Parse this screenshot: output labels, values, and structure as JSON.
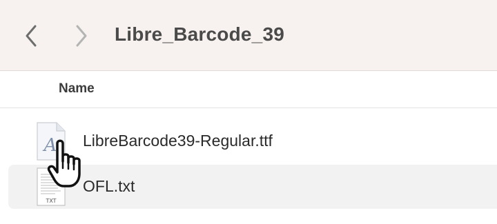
{
  "window": {
    "title": "Libre_Barcode_39"
  },
  "navigation": {
    "back_icon": "chevron-left-icon",
    "forward_icon": "chevron-right-icon"
  },
  "columns": {
    "name_label": "Name"
  },
  "files": [
    {
      "name": "LibreBarcode39-Regular.ttf",
      "icon": "font-file-icon"
    },
    {
      "name": "OFL.txt",
      "icon": "text-file-icon",
      "icon_label": "TXT",
      "selected": true
    }
  ],
  "cursor": {
    "icon": "pointing-hand-cursor-icon"
  },
  "colors": {
    "toolbar_bg": "#f7f2ef",
    "selected_row_bg": "#f2f2f2",
    "title_text": "#4a4a4a"
  }
}
